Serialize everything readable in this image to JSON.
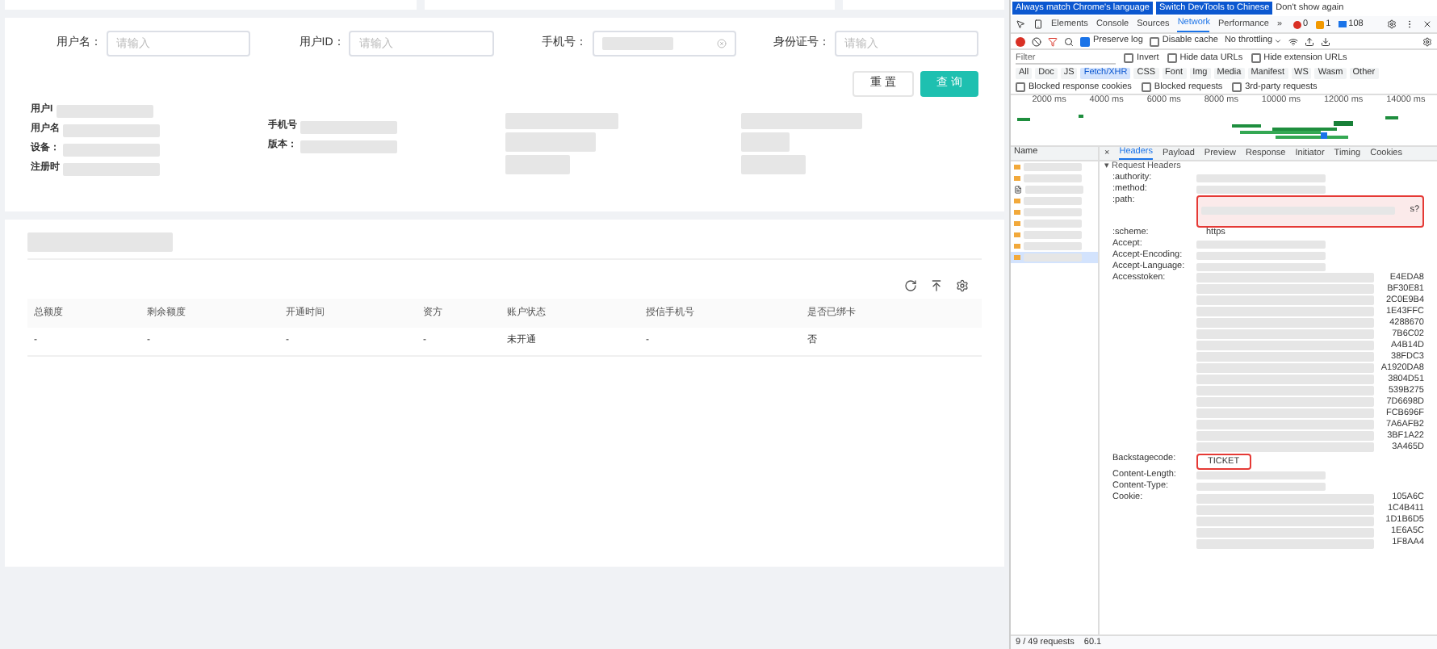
{
  "app": {
    "search_fields": [
      {
        "label": "用户名：",
        "kind": "empty",
        "placeholder": "请输入"
      },
      {
        "label": "用户ID：",
        "kind": "empty",
        "placeholder": "请输入"
      },
      {
        "label": "手机号：",
        "kind": "redacted"
      },
      {
        "label": "身份证号：",
        "kind": "empty",
        "placeholder": "请输入"
      }
    ],
    "buttons": [
      {
        "label": "重 置",
        "kind": "default"
      },
      {
        "label": "查 询",
        "kind": "primary"
      }
    ],
    "info_columns": [
      [
        {
          "label": "用户I"
        },
        {
          "label": "用户名"
        },
        {
          "label": "设备："
        },
        {
          "label": "注册时"
        }
      ],
      [
        {
          "label": "手机号"
        },
        {
          "label": "版本："
        }
      ]
    ],
    "table": {
      "columns": [
        "总额度",
        "剩余额度",
        "开通时间",
        "资方",
        "账户状态",
        "授信手机号",
        "是否已绑卡"
      ],
      "rows": [
        [
          "-",
          "-",
          "-",
          "-",
          "未开通",
          "-",
          "否"
        ]
      ]
    }
  },
  "devtools": {
    "banner": [
      {
        "label": "Always match Chrome's language",
        "kind": "button"
      },
      {
        "label": "Switch DevTools to Chinese",
        "kind": "button"
      },
      {
        "label": "Don't show again",
        "kind": "link"
      }
    ],
    "tabs": [
      {
        "label": "Elements",
        "selected": false
      },
      {
        "label": "Console",
        "selected": false
      },
      {
        "label": "Sources",
        "selected": false
      },
      {
        "label": "Network",
        "selected": true
      },
      {
        "label": "Performance",
        "selected": false
      },
      {
        "label": "»",
        "selected": false
      }
    ],
    "counts": {
      "errors": "0",
      "warnings": "1",
      "messages": "108"
    },
    "toolbar": {
      "preserve_log": {
        "label": "Preserve log",
        "checked": true
      },
      "disable_cache": {
        "label": "Disable cache",
        "checked": false
      },
      "throttling": "No throttling"
    },
    "filter": {
      "placeholder": "Filter",
      "options": [
        {
          "label": "Invert",
          "checked": false
        },
        {
          "label": "Hide data URLs",
          "checked": false
        },
        {
          "label": "Hide extension URLs",
          "checked": false
        }
      ]
    },
    "types": [
      {
        "label": "All",
        "selected": false
      },
      {
        "label": "Doc",
        "selected": false
      },
      {
        "label": "JS",
        "selected": false
      },
      {
        "label": "Fetch/XHR",
        "selected": true
      },
      {
        "label": "CSS",
        "selected": false
      },
      {
        "label": "Font",
        "selected": false
      },
      {
        "label": "Img",
        "selected": false
      },
      {
        "label": "Media",
        "selected": false
      },
      {
        "label": "Manifest",
        "selected": false
      },
      {
        "label": "WS",
        "selected": false
      },
      {
        "label": "Wasm",
        "selected": false
      },
      {
        "label": "Other",
        "selected": false
      }
    ],
    "blocked": [
      {
        "label": "Blocked response cookies",
        "checked": false
      },
      {
        "label": "Blocked requests",
        "checked": false
      },
      {
        "label": "3rd-party requests",
        "checked": false
      }
    ],
    "timeline_ticks": [
      "2000 ms",
      "4000 ms",
      "6000 ms",
      "8000 ms",
      "10000 ms",
      "12000 ms",
      "14000 ms"
    ],
    "name_header": "Name",
    "requests": [
      {
        "kind": "xhr",
        "selected": false
      },
      {
        "kind": "xhr",
        "selected": false
      },
      {
        "kind": "doc",
        "selected": false
      },
      {
        "kind": "xhr",
        "selected": false
      },
      {
        "kind": "xhr",
        "selected": false
      },
      {
        "kind": "xhr",
        "selected": false
      },
      {
        "kind": "xhr",
        "selected": false
      },
      {
        "kind": "xhr",
        "selected": false
      },
      {
        "kind": "xhr",
        "selected": true
      }
    ],
    "detail_tabs": [
      {
        "label": "×",
        "selected": false
      },
      {
        "label": "Headers",
        "selected": true
      },
      {
        "label": "Payload",
        "selected": false
      },
      {
        "label": "Preview",
        "selected": false
      },
      {
        "label": "Response",
        "selected": false
      },
      {
        "label": "Initiator",
        "selected": false
      },
      {
        "label": "Timing",
        "selected": false
      },
      {
        "label": "Cookies",
        "selected": false
      }
    ],
    "section_title": "▾ Request Headers",
    "headers": [
      {
        "name": ":authority:",
        "kind": "redacted"
      },
      {
        "name": ":method:",
        "kind": "redacted"
      },
      {
        "name": ":path:",
        "kind": "redacted",
        "highlighted": true,
        "tail": "s?"
      },
      {
        "name": ":scheme:",
        "kind": "text",
        "value": "https",
        "highlighted": false
      },
      {
        "name": "Accept:",
        "kind": "redacted"
      },
      {
        "name": "Accept-Encoding:",
        "kind": "redacted"
      },
      {
        "name": "Accept-Language:",
        "kind": "redacted"
      },
      {
        "name": "Accesstoken:",
        "kind": "fragments",
        "fragments": [
          "E4EDA8",
          "BF30E81",
          "2C0E9B4",
          "1E43FFC",
          "4288670",
          "7B6C02",
          "A4B14D",
          "38FDC3",
          "A1920DA8",
          "3804D51",
          "539B275",
          "7D6698D",
          "FCB696F",
          "7A6AFB2",
          "3BF1A22",
          "3A465D"
        ]
      },
      {
        "name": "Backstagecode:",
        "kind": "text",
        "value": "TICKET",
        "highlighted": true
      },
      {
        "name": "Content-Length:",
        "kind": "redacted"
      },
      {
        "name": "Content-Type:",
        "kind": "redacted"
      },
      {
        "name": "Cookie:",
        "kind": "fragments",
        "fragments": [
          "105A6C",
          "1C4B411",
          "1D1B6D5",
          "1E6A5C",
          "1F8AA4"
        ]
      }
    ],
    "status": [
      "9 / 49 requests",
      "60.1"
    ]
  }
}
